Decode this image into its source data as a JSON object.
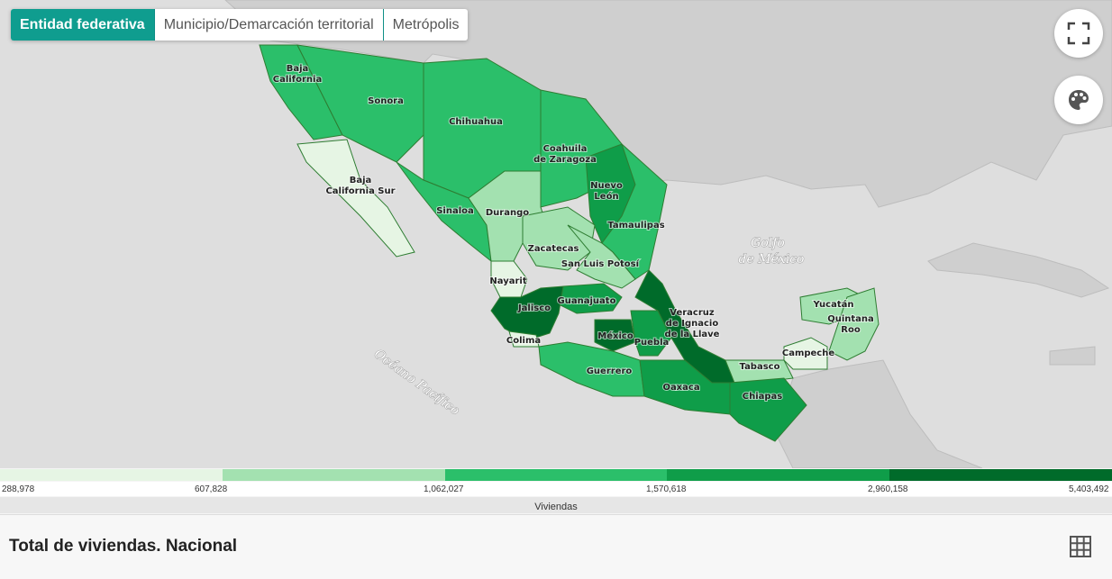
{
  "tabs": [
    {
      "label": "Entidad federativa",
      "active": true
    },
    {
      "label": "Municipio/Demarcación territorial",
      "active": false
    },
    {
      "label": "Metrópolis",
      "active": false
    }
  ],
  "controls": {
    "fullscreen_icon": "fullscreen-icon",
    "palette_icon": "palette-icon",
    "table_icon": "grid-table-icon"
  },
  "sea_labels": {
    "gulf_line1": "Golfo",
    "gulf_line2": "de México",
    "pacific": "Océano Pacífico"
  },
  "states": [
    {
      "name": "Baja California",
      "lines": [
        "Baja",
        "California"
      ],
      "class": 2
    },
    {
      "name": "Sonora",
      "lines": [
        "Sonora"
      ],
      "class": 2
    },
    {
      "name": "Chihuahua",
      "lines": [
        "Chihuahua"
      ],
      "class": 2
    },
    {
      "name": "Coahuila de Zaragoza",
      "lines": [
        "Coahuila",
        "de Zaragoza"
      ],
      "class": 2
    },
    {
      "name": "Baja California Sur",
      "lines": [
        "Baja",
        "California Sur"
      ],
      "class": 0
    },
    {
      "name": "Nuevo León",
      "lines": [
        "Nuevo",
        "León"
      ],
      "class": 3
    },
    {
      "name": "Sinaloa",
      "lines": [
        "Sinaloa"
      ],
      "class": 2
    },
    {
      "name": "Durango",
      "lines": [
        "Durango"
      ],
      "class": 1
    },
    {
      "name": "Tamaulipas",
      "lines": [
        "Tamaulipas"
      ],
      "class": 2
    },
    {
      "name": "Zacatecas",
      "lines": [
        "Zacatecas"
      ],
      "class": 1
    },
    {
      "name": "San Luis Potosí",
      "lines": [
        "San Luis Potosí"
      ],
      "class": 1
    },
    {
      "name": "Nayarit",
      "lines": [
        "Nayarit"
      ],
      "class": 0
    },
    {
      "name": "Guanajuato",
      "lines": [
        "Guanajuato"
      ],
      "class": 3
    },
    {
      "name": "Jalisco",
      "lines": [
        "Jalisco"
      ],
      "class": 4
    },
    {
      "name": "Colima",
      "lines": [
        "Colima"
      ],
      "class": 0
    },
    {
      "name": "México",
      "lines": [
        "México"
      ],
      "class": 4
    },
    {
      "name": "Puebla",
      "lines": [
        "Puebla"
      ],
      "class": 3
    },
    {
      "name": "Veracruz de Ignacio de la Llave",
      "lines": [
        "Veracruz",
        "de Ignacio",
        "de la Llave"
      ],
      "class": 4
    },
    {
      "name": "Guerrero",
      "lines": [
        "Guerrero"
      ],
      "class": 2
    },
    {
      "name": "Oaxaca",
      "lines": [
        "Oaxaca"
      ],
      "class": 3
    },
    {
      "name": "Tabasco",
      "lines": [
        "Tabasco"
      ],
      "class": 1
    },
    {
      "name": "Chiapas",
      "lines": [
        "Chiapas"
      ],
      "class": 3
    },
    {
      "name": "Campeche",
      "lines": [
        "Campeche"
      ],
      "class": 0
    },
    {
      "name": "Yucatán",
      "lines": [
        "Yucatán"
      ],
      "class": 1
    },
    {
      "name": "Quintana Roo",
      "lines": [
        "Quintana",
        "Roo"
      ],
      "class": 1
    }
  ],
  "legend": {
    "colors": [
      "#e6f5e4",
      "#a3e1b0",
      "#2bbf6a",
      "#0f9d49",
      "#006b2a"
    ],
    "breaks": [
      "288,978",
      "607,828",
      "1,062,027",
      "1,570,618",
      "2,960,158",
      "5,403,492"
    ],
    "title": "Viviendas"
  },
  "footer": {
    "title": "Total de viviendas. Nacional"
  },
  "colors": {
    "sea": "#dedede",
    "land": "#cfcfcf",
    "tab_active": "#0f9d8f",
    "border": "#2e7d32"
  }
}
